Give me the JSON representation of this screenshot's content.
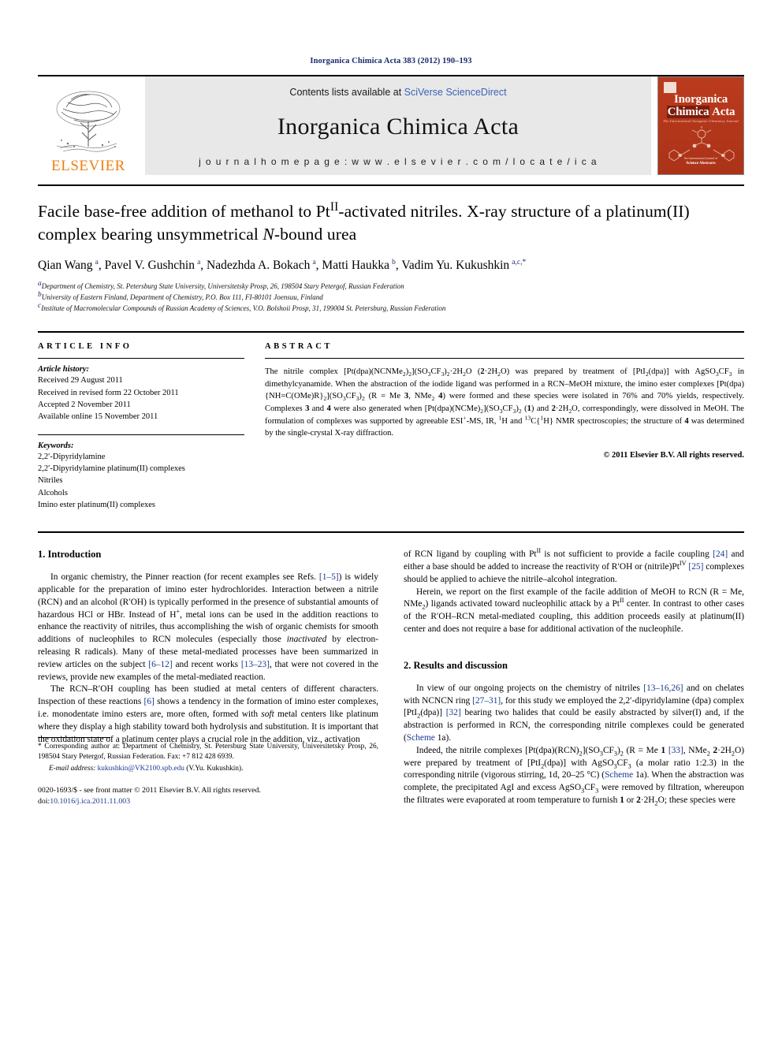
{
  "running_head": "Inorganica Chimica Acta 383 (2012) 190–193",
  "masthead": {
    "publisher_name": "ELSEVIER",
    "contents_prefix": "Contents lists available at ",
    "contents_link": "SciVerse ScienceDirect",
    "journal_title": "Inorganica Chimica Acta",
    "homepage": "j o u r n a l   h o m e p a g e :   w w w . e l s e v i e r . c o m / l o c a t e / i c a",
    "cover": {
      "line1": "Inorganica",
      "line2_a": "Chimica",
      "line2_b": "Acta",
      "subtitle": "The International Inorganic Chemistry Journal",
      "footer_small": "An international journal of",
      "footer_bold": "Science Abstracts"
    }
  },
  "title": "Facile base-free addition of methanol to Pt -activated nitriles. X-ray structure of a platinum(II) complex bearing unsymmetrical N-bound urea",
  "authors_raw": "Qian Wang a, Pavel V. Gushchin a, Nadezhda A. Bokach a, Matti Haukka b, Vadim Yu. Kukushkin a,c,*",
  "affiliations": [
    "Department of Chemistry, St. Petersburg State University, Universitetsky Prosp, 26, 198504 Stary Petergof, Russian Federation",
    "University of Eastern Finland, Department of Chemistry, P.O. Box 111, FI-80101 Joensuu, Finland",
    "Institute of Macromolecular Compounds of Russian Academy of Sciences, V.O. Bolshoii Prosp, 31, 199004 St. Petersburg, Russian Federation"
  ],
  "article_info": {
    "heading": "ARTICLE INFO",
    "history_label": "Article history:",
    "history": [
      "Received 29 August 2011",
      "Received in revised form 22 October 2011",
      "Accepted 2 November 2011",
      "Available online 15 November 2011"
    ],
    "keywords_label": "Keywords:",
    "keywords": [
      "2,2′-Dipyridylamine",
      "2,2′-Dipyridylamine platinum(II) complexes",
      "Nitriles",
      "Alcohols",
      "Imino ester platinum(II) complexes"
    ]
  },
  "abstract": {
    "heading": "ABSTRACT",
    "copyright": "© 2011 Elsevier B.V. All rights reserved."
  },
  "sections": {
    "introduction_heading": "1. Introduction",
    "results_heading": "2. Results and discussion"
  },
  "footnotes": {
    "corresponding": "* Corresponding author at: Department of Chemistry, St. Petersburg State University, Universitetsky Prosp, 26, 198504 Stary Petergof, Russian Federation. Fax: +7 812 428 6939.",
    "email_label": "E-mail address:",
    "email": "kukushkin@VK2100.spb.edu",
    "email_owner": "(V.Yu. Kukushkin)."
  },
  "imprint": {
    "line1": "0020-1693/$ - see front matter © 2011 Elsevier B.V. All rights reserved.",
    "doi_label": "doi:",
    "doi": "10.1016/j.ica.2011.11.003"
  },
  "colors": {
    "link": "#1a3a8f",
    "runhead": "#1a2a6c",
    "elsevier_orange": "#f07f13",
    "cover_red": "#b5381f"
  }
}
